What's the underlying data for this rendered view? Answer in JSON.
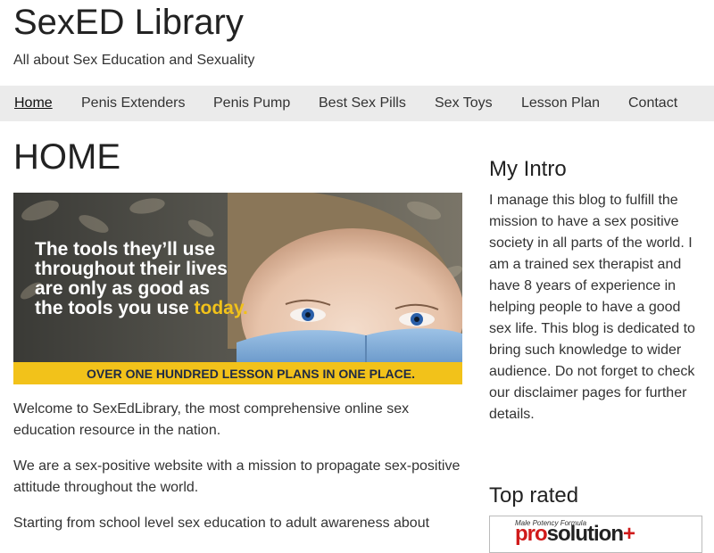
{
  "header": {
    "site_title": "SexED Library",
    "tagline": "All about Sex Education and Sexuality"
  },
  "nav": {
    "items": [
      {
        "label": "Home",
        "active": true
      },
      {
        "label": "Penis Extenders",
        "active": false
      },
      {
        "label": "Penis Pump",
        "active": false
      },
      {
        "label": "Best Sex Pills",
        "active": false
      },
      {
        "label": "Sex Toys",
        "active": false
      },
      {
        "label": "Lesson Plan",
        "active": false
      },
      {
        "label": "Contact",
        "active": false
      }
    ]
  },
  "main": {
    "title": "HOME",
    "hero": {
      "caption_lines": [
        "The tools they’ll use",
        "throughout their lives",
        "are only as good as",
        "the tools you use "
      ],
      "caption_highlight": "today.",
      "banner": "OVER ONE HUNDRED LESSON PLANS IN ONE PLACE."
    },
    "paragraphs": [
      "Welcome to SexEdLibrary, the most comprehensive online sex education resource in the nation.",
      "We are a sex-positive website with a mission to propagate sex-positive attitude throughout the world.",
      "Starting from school level sex education to adult awareness about"
    ]
  },
  "sidebar": {
    "intro_heading": "My Intro",
    "intro_text": "I manage this blog to fulfill the mission to have a sex positive society in all parts of the world. I am a trained sex therapist and have 8 years of experience in helping people to have a good sex life. This blog is dedicated to bring such knowledge to wider audience. Do not forget to check our disclaimer pages for further details.",
    "top_rated_heading": "Top rated",
    "ad": {
      "small_text": "Male Potency Formula",
      "brand_main": "pro",
      "brand_rest": "solution",
      "brand_plus": "+"
    }
  },
  "colors": {
    "nav_background": "#ebebeb",
    "hero_banner": "#f2c21a",
    "hero_highlight": "#f2c21a",
    "ad_accent": "#d01a1a"
  }
}
